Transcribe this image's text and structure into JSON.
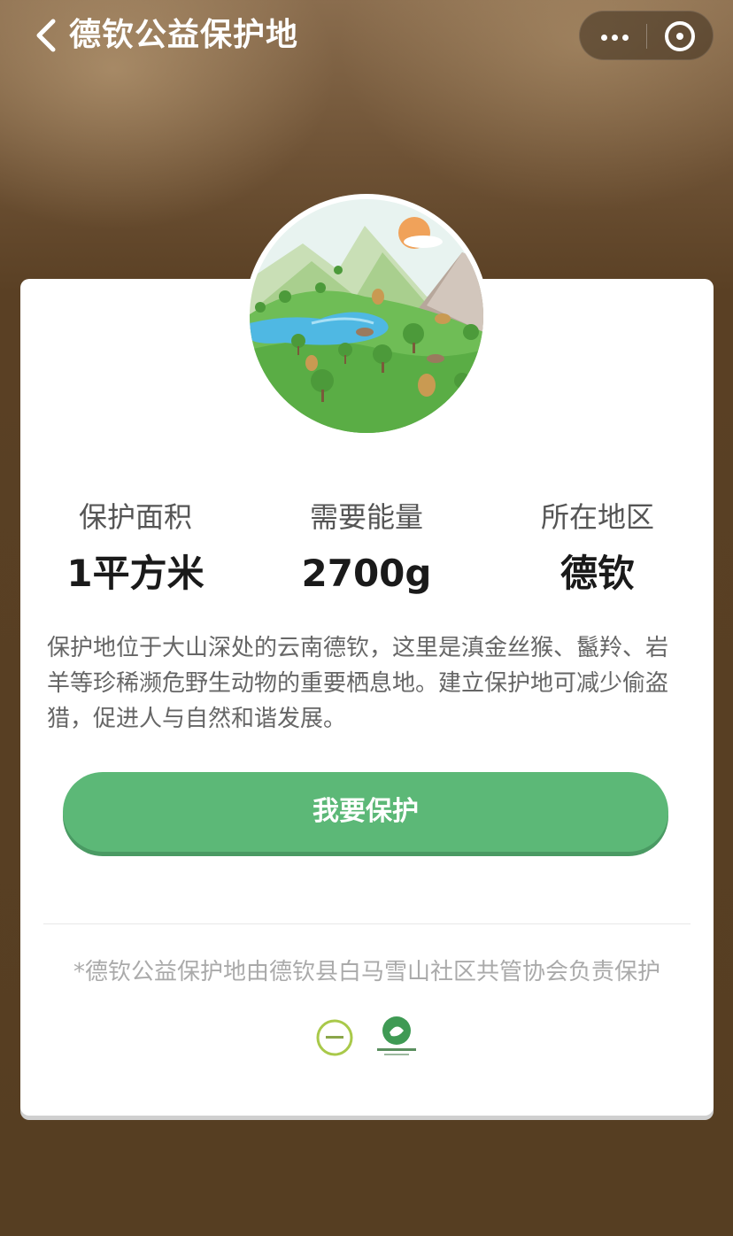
{
  "nav": {
    "title": "德钦公益保护地"
  },
  "stats": [
    {
      "label": "保护面积",
      "value": "1平方米"
    },
    {
      "label": "需要能量",
      "value": "2700g"
    },
    {
      "label": "所在地区",
      "value": "德钦"
    }
  ],
  "description": "保护地位于大山深处的云南德钦，这里是滇金丝猴、鬣羚、岩羊等珍稀濒危野生动物的重要栖息地。建立保护地可减少偷盗猎，促进人与自然和谐发展。",
  "cta_label": "我要保护",
  "footnote": "*德钦公益保护地由德钦县白马雪山社区共管协会负责保护",
  "colors": {
    "accent_green": "#5cb877",
    "background_brown": "#563e22"
  }
}
